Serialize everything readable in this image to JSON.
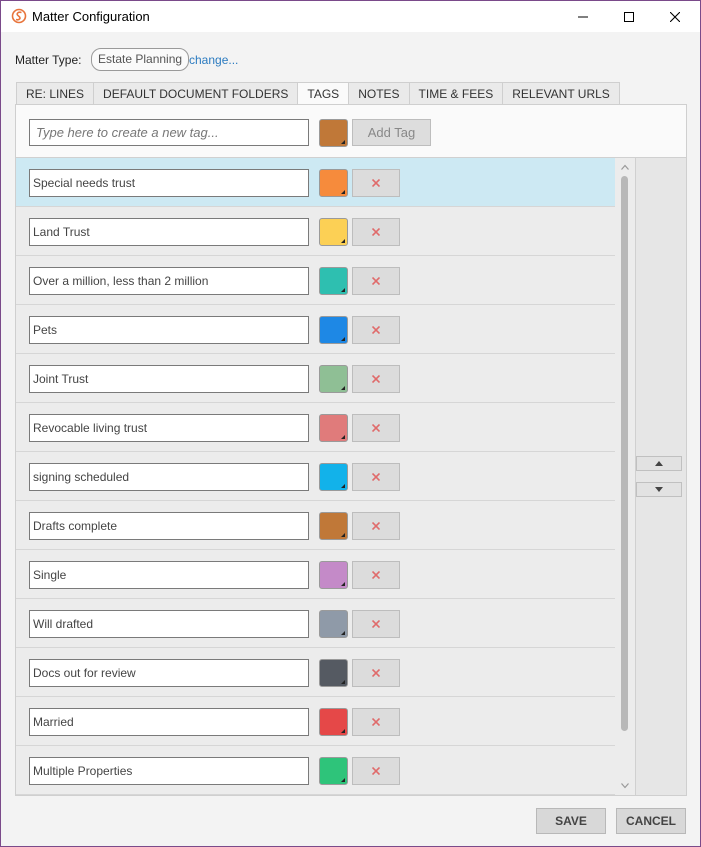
{
  "window": {
    "title": "Matter Configuration"
  },
  "matter": {
    "label": "Matter Type:",
    "value": "Estate Planning",
    "change_link": "change..."
  },
  "tabs": [
    {
      "label": "RE: LINES",
      "active": false
    },
    {
      "label": "DEFAULT DOCUMENT FOLDERS",
      "active": false
    },
    {
      "label": "TAGS",
      "active": true
    },
    {
      "label": "NOTES",
      "active": false
    },
    {
      "label": "TIME & FEES",
      "active": false
    },
    {
      "label": "RELEVANT URLS",
      "active": false
    }
  ],
  "new_tag": {
    "placeholder": "Type here to create a new tag...",
    "color": "#c07838",
    "add_label": "Add Tag"
  },
  "tags": [
    {
      "name": "Special needs trust",
      "color": "#f68b3c",
      "selected": true
    },
    {
      "name": "Land Trust",
      "color": "#fcd055",
      "selected": false
    },
    {
      "name": "Over a million, less than 2 million",
      "color": "#2ebfb0",
      "selected": false
    },
    {
      "name": "Pets",
      "color": "#1e88e5",
      "selected": false
    },
    {
      "name": "Joint Trust",
      "color": "#8fbf95",
      "selected": false
    },
    {
      "name": "Revocable living trust",
      "color": "#e07b7b",
      "selected": false
    },
    {
      "name": "signing scheduled",
      "color": "#12b2ea",
      "selected": false
    },
    {
      "name": "Drafts complete",
      "color": "#c07838",
      "selected": false
    },
    {
      "name": "Single",
      "color": "#c48ac8",
      "selected": false
    },
    {
      "name": "Will drafted",
      "color": "#8f9aa8",
      "selected": false
    },
    {
      "name": "Docs out for review",
      "color": "#555a62",
      "selected": false
    },
    {
      "name": "Married",
      "color": "#e54848",
      "selected": false
    },
    {
      "name": "Multiple Properties",
      "color": "#2ec47a",
      "selected": false
    }
  ],
  "footer": {
    "save_label": "SAVE",
    "cancel_label": "CANCEL"
  }
}
